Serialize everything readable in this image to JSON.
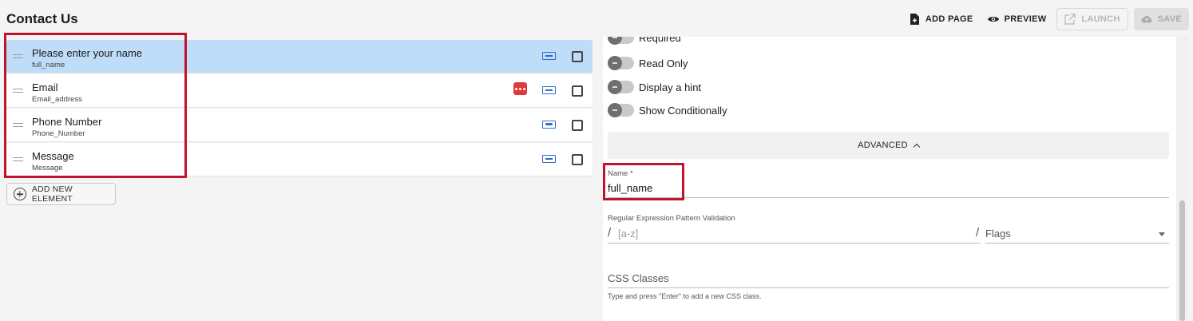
{
  "header": {
    "title": "Contact Us",
    "actions": {
      "add_page": "ADD PAGE",
      "preview": "PREVIEW",
      "launch": "LAUNCH",
      "save": "SAVE"
    }
  },
  "elements": [
    {
      "label": "Please enter your name",
      "key": "full_name",
      "type_icon": "text-field-icon",
      "selected": true
    },
    {
      "label": "Email",
      "key": "Email_address",
      "type_icon": "text-field-icon",
      "badge": "more-options-icon"
    },
    {
      "label": "Phone Number",
      "key": "Phone_Number",
      "type_icon": "phone-field-icon"
    },
    {
      "label": "Message",
      "key": "Message",
      "type_icon": "text-field-icon"
    }
  ],
  "add_element_label": "ADD NEW ELEMENT",
  "settings": {
    "toggles": [
      "Required",
      "Read Only",
      "Display a hint",
      "Show Conditionally"
    ],
    "advanced_label": "ADVANCED",
    "name_field": {
      "label": "Name *",
      "value": "full_name"
    },
    "regex_field": {
      "label": "Regular Expression Pattern Validation",
      "prefix": "/",
      "placeholder": "[a-z]",
      "separator": "/",
      "flags_placeholder": "Flags"
    },
    "css_field": {
      "placeholder": "CSS Classes",
      "hint": "Type and press \"Enter\" to add a new CSS class."
    }
  },
  "colors": {
    "selected_row": "#bfdcf8",
    "highlight_box": "#c0142b",
    "badge": "#dd3b3b",
    "type_icon": "#2f6fc4"
  }
}
